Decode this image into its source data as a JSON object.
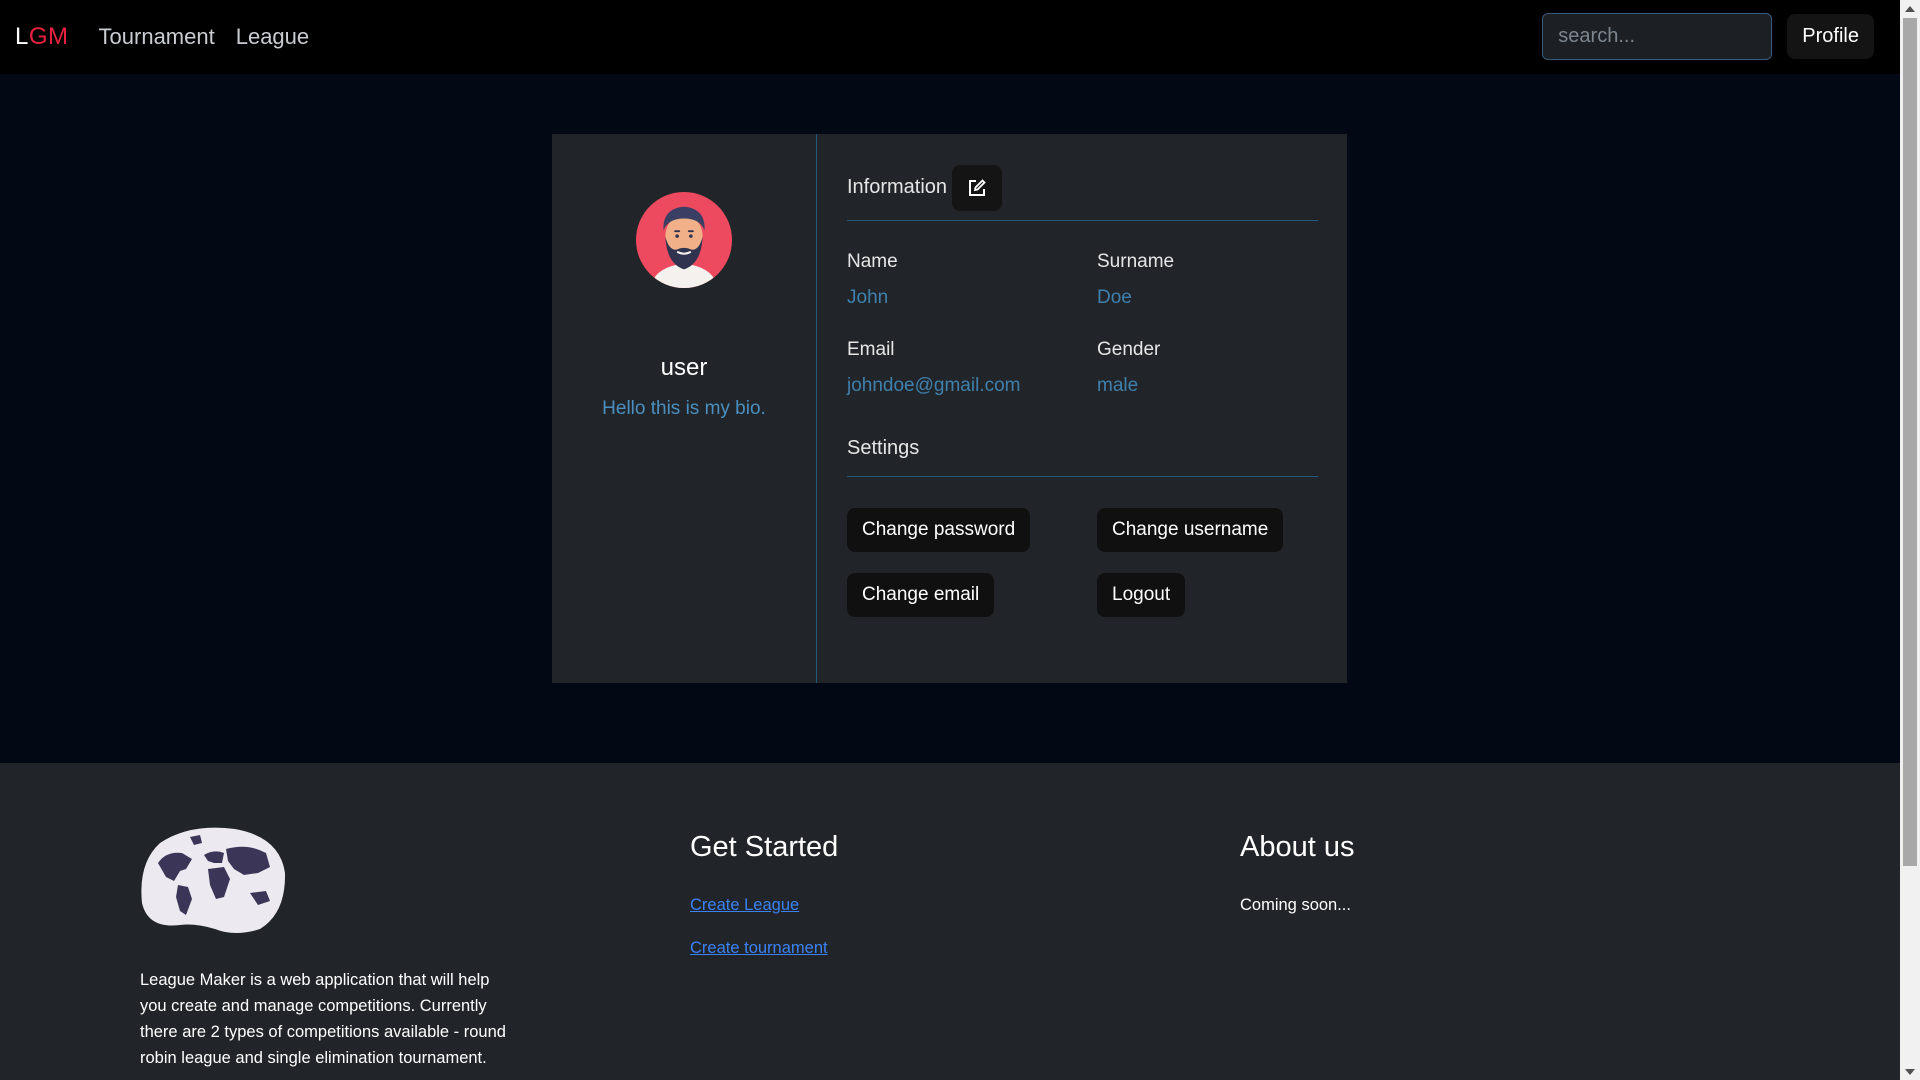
{
  "navbar": {
    "brand_first": "L",
    "brand_rest": "GM",
    "links": [
      "Tournament",
      "League"
    ],
    "search_placeholder": "search...",
    "profile_label": "Profile"
  },
  "profile": {
    "username": "user",
    "bio": "Hello this is my bio.",
    "information_title": "Information",
    "fields": {
      "name_label": "Name",
      "name_value": "John",
      "surname_label": "Surname",
      "surname_value": "Doe",
      "email_label": "Email",
      "email_value": "johndoe@gmail.com",
      "gender_label": "Gender",
      "gender_value": "male"
    },
    "settings_title": "Settings",
    "buttons": {
      "change_password": "Change password",
      "change_username": "Change username",
      "change_email": "Change email",
      "logout": "Logout"
    }
  },
  "footer": {
    "description": "League Maker is a web application that will help you create and manage competitions. Currently there are 2 types of competitions available - round robin league and single elimination tournament.",
    "get_started_title": "Get Started",
    "create_league": "Create League",
    "create_tournament": "Create tournament",
    "about_title": "About us",
    "about_text": "Coming soon..."
  },
  "colors": {
    "brand_accent": "#e8213f",
    "link_blue": "#3b82f6",
    "value_blue": "#3f80ad",
    "page_bg": "#020814",
    "card_bg": "#212529"
  }
}
